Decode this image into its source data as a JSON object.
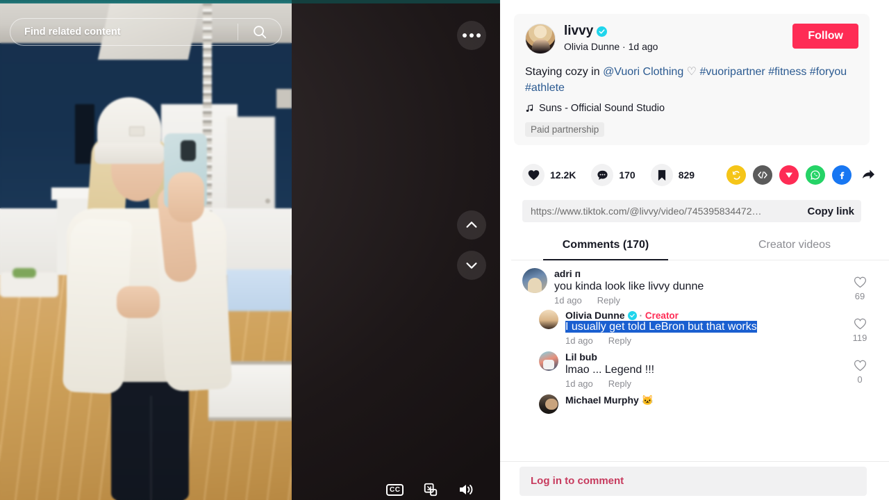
{
  "video": {
    "search_placeholder": "Find related content",
    "search_icon": "search-icon",
    "more_icon": "more-options-icon",
    "prev_icon": "chevron-up-icon",
    "next_icon": "chevron-down-icon",
    "cc_label": "CC",
    "quality_icon": "video-quality-icon",
    "volume_icon": "volume-on-icon"
  },
  "post": {
    "handle": "livvy",
    "verified_icon": "verified-badge-icon",
    "display_name": "Olivia Dunne",
    "separator": "·",
    "time_ago": "1d ago",
    "follow_label": "Follow",
    "caption_prefix": "Staying cozy in ",
    "caption_mention": "@Vuori Clothing",
    "caption_emoji": "♡",
    "hashtags": [
      "#vuoripartner",
      "#fitness",
      "#foryou",
      "#athlete"
    ],
    "music_icon": "music-note-icon",
    "music_title": "Suns - Official Sound Studio",
    "paid_partnership": "Paid partnership"
  },
  "engagement": {
    "like_icon": "heart-filled-icon",
    "likes": "12.2K",
    "comment_icon": "comment-bubble-icon",
    "comments": "170",
    "bookmark_icon": "bookmark-filled-icon",
    "bookmarks": "829",
    "shares": [
      {
        "name": "repost-icon",
        "color": "#f5c518"
      },
      {
        "name": "embed-code-icon",
        "color": "#5b5b5b"
      },
      {
        "name": "telegram-icon",
        "color": "#fe2c55"
      },
      {
        "name": "whatsapp-icon",
        "color": "#25d366"
      },
      {
        "name": "facebook-icon",
        "color": "#1877f2"
      },
      {
        "name": "share-arrow-icon",
        "color": "#161823"
      }
    ]
  },
  "link": {
    "url": "https://www.tiktok.com/@livvy/video/745395834472…",
    "copy_label": "Copy link"
  },
  "tabs": [
    {
      "label": "Comments (170)",
      "active": true
    },
    {
      "label": "Creator videos",
      "active": false
    }
  ],
  "comments": [
    {
      "author": "adri ᴨ",
      "text": "you kinda look like livvy dunne",
      "time_ago": "1d ago",
      "reply_label": "Reply",
      "likes": "69",
      "like_icon": "heart-outline-icon",
      "is_reply": false,
      "verified": false,
      "creator": false,
      "selected": false
    },
    {
      "author": "Olivia Dunne",
      "text": "I usually get told LeBron but that works",
      "time_ago": "1d ago",
      "reply_label": "Reply",
      "likes": "119",
      "like_icon": "heart-outline-icon",
      "is_reply": true,
      "verified": true,
      "creator": true,
      "creator_label": "Creator",
      "selected": true
    },
    {
      "author": "Lil bub",
      "text": "lmao ... Legend !!!",
      "time_ago": "1d ago",
      "reply_label": "Reply",
      "likes": "0",
      "like_icon": "heart-outline-icon",
      "is_reply": true,
      "verified": false,
      "creator": false,
      "selected": false
    },
    {
      "author": "Michael Murphy 🐱",
      "text": "",
      "time_ago": "",
      "reply_label": "",
      "likes": "",
      "like_icon": "heart-outline-icon",
      "is_reply": true,
      "verified": false,
      "creator": false,
      "selected": false
    }
  ],
  "footer": {
    "login_label": "Log in to comment"
  },
  "colors": {
    "brand_red": "#fe2c55",
    "verified_blue": "#20d5ec",
    "selection_blue": "#1a5fd0",
    "top_strip_teal": "#1a6a6c"
  }
}
